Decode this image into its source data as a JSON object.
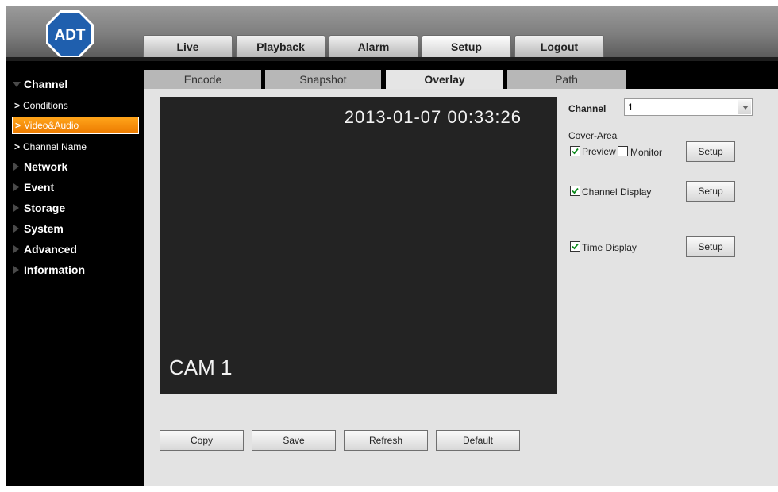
{
  "brand": {
    "logo_text": "ADT",
    "logo_color": "#1f5fae"
  },
  "main_tabs": [
    {
      "label": "Live"
    },
    {
      "label": "Playback"
    },
    {
      "label": "Alarm"
    },
    {
      "label": "Setup",
      "active": true
    },
    {
      "label": "Logout"
    }
  ],
  "sidebar": {
    "categories": [
      {
        "label": "Channel",
        "expanded": true
      },
      {
        "label": "Network"
      },
      {
        "label": "Event"
      },
      {
        "label": "Storage"
      },
      {
        "label": "System"
      },
      {
        "label": "Advanced"
      },
      {
        "label": "Information"
      }
    ],
    "channel_items": [
      {
        "label": "Conditions"
      },
      {
        "label": "Video&Audio",
        "active": true
      },
      {
        "label": "Channel Name"
      }
    ],
    "active_color": "#f08a00"
  },
  "sub_tabs": [
    {
      "label": "Encode"
    },
    {
      "label": "Snapshot"
    },
    {
      "label": "Overlay",
      "active": true
    },
    {
      "label": "Path"
    }
  ],
  "preview": {
    "time_overlay": "2013-01-07 00:33:26",
    "channel_overlay": "CAM 1"
  },
  "settings": {
    "channel_label": "Channel",
    "channel_value": "1",
    "cover_area_label": "Cover-Area",
    "preview_label": "Preview",
    "preview_checked": true,
    "monitor_label": "Monitor",
    "monitor_checked": false,
    "channel_display_label": "Channel Display",
    "channel_display_checked": true,
    "time_display_label": "Time Display",
    "time_display_checked": true,
    "setup_label": "Setup"
  },
  "actions": {
    "copy": "Copy",
    "save": "Save",
    "refresh": "Refresh",
    "default": "Default"
  }
}
